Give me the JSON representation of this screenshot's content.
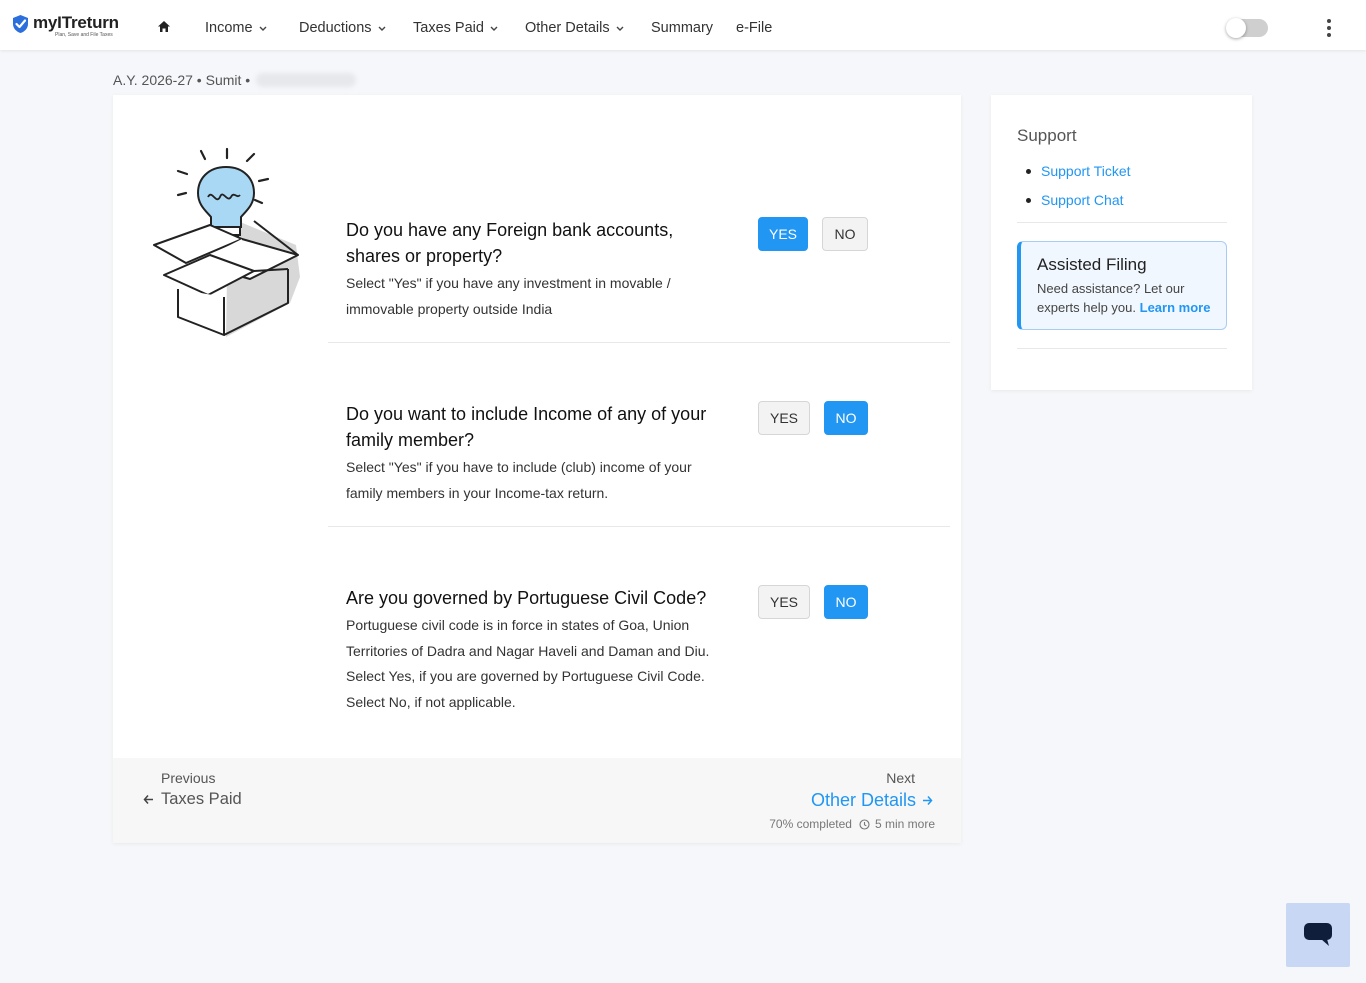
{
  "brand": {
    "name": "myITreturn",
    "tagline": "Plan, Save and File Taxes",
    "accent": "#2196f3"
  },
  "nav": {
    "items": [
      {
        "label": "Income",
        "has_menu": true
      },
      {
        "label": "Deductions",
        "has_menu": true
      },
      {
        "label": "Taxes Paid",
        "has_menu": true
      },
      {
        "label": "Other Details",
        "has_menu": true
      },
      {
        "label": "Summary",
        "has_menu": false
      },
      {
        "label": "e-File",
        "has_menu": false
      }
    ],
    "toggle_on": false
  },
  "breadcrumb": {
    "text": "A.Y. 2026-27 • Sumit •"
  },
  "questions": [
    {
      "title": "Do you have any Foreign bank accounts, shares or property?",
      "description": "Select \"Yes\" if you have any investment in movable / immovable property outside India",
      "yes_label": "YES",
      "no_label": "NO",
      "selected": "YES"
    },
    {
      "title": "Do you want to include Income of any of your family member?",
      "description": "Select \"Yes\" if you have to include (club) income of your family members in your Income-tax return.",
      "yes_label": "YES",
      "no_label": "NO",
      "selected": "NO"
    },
    {
      "title": "Are you governed by Portuguese Civil Code?",
      "description": "Portuguese civil code is in force in states of Goa, Union Territories of Dadra and Nagar Haveli and Daman and Diu. Select Yes, if you are governed by Portuguese Civil Code. Select No, if not applicable.",
      "yes_label": "YES",
      "no_label": "NO",
      "selected": "NO"
    }
  ],
  "footer": {
    "prev_label": "Previous",
    "prev_link": "Taxes Paid",
    "next_label": "Next",
    "next_link": "Other Details",
    "progress_text": "70% completed",
    "time_left": "5 min more",
    "progress_percent": 70
  },
  "sidebar": {
    "support_title": "Support",
    "links": [
      "Support Ticket",
      "Support Chat"
    ],
    "assist_title": "Assisted Filing",
    "assist_text": "Need assistance? Let our experts help you.",
    "assist_link": "Learn more"
  }
}
